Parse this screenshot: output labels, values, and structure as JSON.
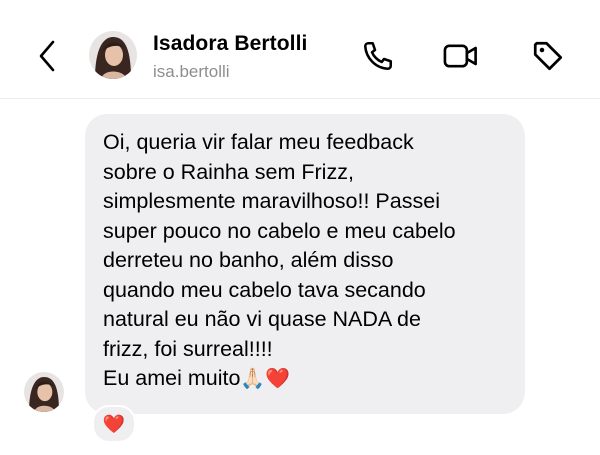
{
  "header": {
    "name": "Isadora Bertolli",
    "username": "isa.bertolli",
    "back_icon": "chevron-left-icon",
    "call_icon": "phone-icon",
    "video_icon": "video-camera-icon",
    "tag_icon": "tag-icon"
  },
  "message": {
    "lines": [
      "Oi, queria vir falar meu feedback",
      "sobre o Rainha sem Frizz,",
      "simplesmente maravilhoso!! Passei",
      "super pouco no cabelo e meu cabelo",
      "derreteu no banho, além disso",
      "quando meu cabelo tava secando",
      "natural eu não vi quase NADA de",
      "frizz, foi surreal!!!!",
      "Eu amei muito"
    ],
    "trailing_emoji": [
      "🙏🏻",
      "❤️"
    ],
    "reaction": "❤️"
  },
  "colors": {
    "bubble_bg": "#efeff1",
    "heart": "#e0192a",
    "secondary_text": "#8e8e8e"
  }
}
